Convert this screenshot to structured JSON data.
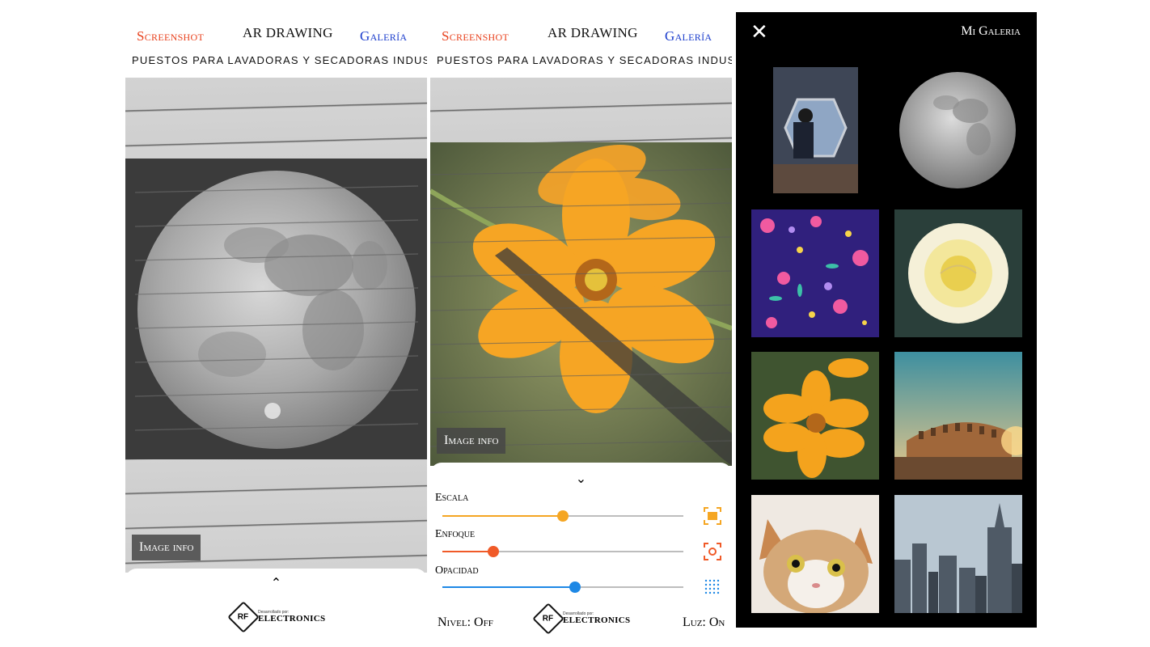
{
  "nav": {
    "screenshot": "Screenshot",
    "ar_drawing": "AR DRAWING",
    "galeria": "Galería",
    "ticker": "PUESTOS PARA LAVADORAS Y SECADORAS INDUSTRIALE",
    "colors": {
      "screenshot": "#e8401c",
      "ar": "#111111",
      "galeria": "#1a3ccc"
    }
  },
  "panel1": {
    "image_info": "Image info",
    "expand_icon": "chevron-up-icon"
  },
  "panel2": {
    "image_info": "Image info",
    "collapse_icon": "chevron-down-icon",
    "controls": {
      "escala": {
        "label": "Escala",
        "value": 0.5,
        "color": "#f5a623",
        "icon": "fit-screen-icon"
      },
      "enfoque": {
        "label": "Enfoque",
        "value": 0.21,
        "color": "#f05a28",
        "icon": "focus-icon"
      },
      "opacidad": {
        "label": "Opacidad",
        "value": 0.55,
        "color": "#1e88e5",
        "icon": "dots-grid-icon"
      }
    },
    "nivel": "Nivel: Off",
    "luz": "Luz: On"
  },
  "logo": {
    "mark": "RF",
    "small": "Desarrollado por:",
    "big": "ELECTRONICS"
  },
  "gallery": {
    "title": "Mi Galeria",
    "close_icon": "close-icon",
    "thumbnails": [
      "astronaut",
      "moon",
      "floral-pattern",
      "white-rose",
      "yellow-flower",
      "colosseum",
      "cat",
      "city-skyline"
    ]
  }
}
